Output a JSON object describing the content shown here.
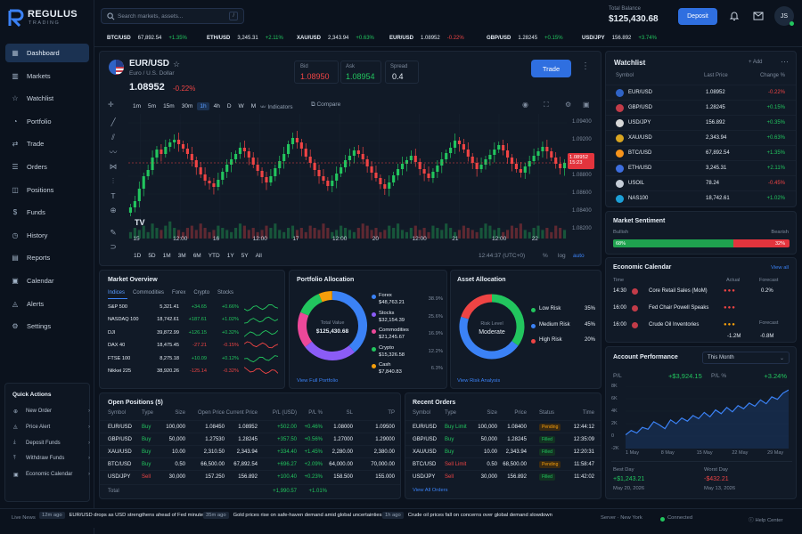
{
  "app": {
    "name": "REGULUS",
    "sub": "TRADING"
  },
  "search": {
    "placeholder": "Search markets, assets...",
    "shortcut": "/"
  },
  "balance": {
    "label": "Total Balance",
    "value": "$125,430.68"
  },
  "deposit_label": "Deposit",
  "user_initials": "JS",
  "nav": [
    {
      "label": "Dashboard",
      "icon": "grid-icon"
    },
    {
      "label": "Markets",
      "icon": "chart-icon"
    },
    {
      "label": "Watchlist",
      "icon": "star-icon"
    },
    {
      "label": "Portfolio",
      "icon": "pie-icon"
    },
    {
      "label": "Trade",
      "icon": "swap-icon"
    },
    {
      "label": "Orders",
      "icon": "list-icon"
    },
    {
      "label": "Positions",
      "icon": "layers-icon"
    },
    {
      "label": "Funds",
      "icon": "dollar-icon"
    },
    {
      "label": "History",
      "icon": "clock-icon"
    },
    {
      "label": "Reports",
      "icon": "file-icon"
    },
    {
      "label": "Calendar",
      "icon": "calendar-icon"
    },
    {
      "label": "Alerts",
      "icon": "bell-icon"
    },
    {
      "label": "Settings",
      "icon": "gear-icon"
    }
  ],
  "quick_actions": {
    "title": "Quick Actions",
    "items": [
      "New Order",
      "Price Alert",
      "Deposit Funds",
      "Withdraw Funds",
      "Economic Calendar"
    ]
  },
  "ticker": [
    {
      "sym": "BTC/USD",
      "price": "67,892.54",
      "chg": "+1.35%",
      "dir": "up"
    },
    {
      "sym": "ETH/USD",
      "price": "3,245.31",
      "chg": "+2.11%",
      "dir": "up"
    },
    {
      "sym": "XAU/USD",
      "price": "2,343.94",
      "chg": "+0.63%",
      "dir": "up"
    },
    {
      "sym": "EUR/USD",
      "price": "1.08952",
      "chg": "-0.22%",
      "dir": "down"
    },
    {
      "sym": "GBP/USD",
      "price": "1.28245",
      "chg": "+0.15%",
      "dir": "up"
    },
    {
      "sym": "USD/JPY",
      "price": "156.892",
      "chg": "+3.74%",
      "dir": "up"
    }
  ],
  "chart": {
    "pair": "EUR/USD",
    "desc": "Euro / U.S. Dollar",
    "price": "1.08952",
    "change": "-0.22%",
    "bid_label": "Bid",
    "bid": "1.08950",
    "ask_label": "Ask",
    "ask": "1.08954",
    "spread_label": "Spread",
    "spread": "0.4",
    "trade_label": "Trade",
    "timeframes": [
      "1m",
      "5m",
      "15m",
      "30m",
      "1h",
      "4h",
      "D",
      "W",
      "M"
    ],
    "active_tf": "1h",
    "indicators_label": "Indicators",
    "compare_label": "Compare",
    "yticks": [
      "1.09400",
      "1.09200",
      "1.09000",
      "1.08800",
      "1.08600",
      "1.08400",
      "1.08200"
    ],
    "xticks": [
      "15",
      "12:00",
      "16",
      "12:00",
      "17",
      "12:00",
      "20",
      "12:00",
      "21",
      "12:00",
      "22"
    ],
    "last_price": "1.08952",
    "last_time": "15:23",
    "ranges": [
      "1D",
      "5D",
      "1M",
      "3M",
      "6M",
      "YTD",
      "1Y",
      "5Y",
      "All"
    ],
    "clock": "12:44:37 (UTC+0)",
    "pct": "%",
    "log": "log",
    "auto": "auto"
  },
  "chart_data": {
    "type": "candlestick",
    "ylim": [
      1.081,
      1.095
    ],
    "closes": [
      1.0845,
      1.0852,
      1.0866,
      1.088,
      1.0887,
      1.0901,
      1.091,
      1.0905,
      1.0913,
      1.0918,
      1.0921,
      1.0916,
      1.0911,
      1.0905,
      1.0898,
      1.089,
      1.0882,
      1.0875,
      1.0872,
      1.0868,
      1.0876,
      1.0885,
      1.0893,
      1.0899,
      1.0905,
      1.0912,
      1.0908,
      1.0901,
      1.0893,
      1.0886,
      1.0879,
      1.0873,
      1.088,
      1.0889,
      1.0897,
      1.0905,
      1.0916,
      1.0923,
      1.0918,
      1.0911,
      1.0902,
      1.0895,
      1.0887,
      1.088,
      1.0875,
      1.0869,
      1.0875,
      1.0883,
      1.089,
      1.0898,
      1.0903,
      1.0909,
      1.0905,
      1.0899,
      1.0891,
      1.0884,
      1.0878,
      1.0871,
      1.0866,
      1.0873,
      1.0881,
      1.0888,
      1.0894,
      1.0898,
      1.0903,
      1.0896,
      1.0888,
      1.0883,
      1.0878,
      1.0885,
      1.0892,
      1.0899,
      1.0906,
      1.0912,
      1.092,
      1.0916,
      1.091,
      1.0902,
      1.0895,
      1.0888,
      1.0893,
      1.0899,
      1.0904,
      1.091,
      1.0915,
      1.0909,
      1.0901,
      1.0894,
      1.0888,
      1.0884,
      1.0891,
      1.0897,
      1.0903,
      1.0908,
      1.0913,
      1.0908,
      1.0901,
      1.0894,
      1.0889,
      1.0895
    ],
    "volumes": [
      3,
      5,
      4,
      6,
      3,
      7,
      5,
      4,
      6,
      8,
      5,
      4,
      3,
      5,
      6,
      4,
      7,
      5,
      3,
      4,
      6,
      5,
      4,
      3,
      5,
      7,
      6,
      4,
      5,
      3,
      4,
      6,
      5,
      7,
      4,
      3,
      5,
      6,
      4,
      5,
      3,
      6,
      5,
      4,
      7,
      5,
      3,
      4,
      6,
      5,
      4,
      3,
      5,
      7,
      6,
      4,
      5,
      3,
      4,
      6,
      5,
      7,
      4,
      3,
      5,
      6,
      4,
      5,
      3,
      6,
      5,
      4,
      7,
      5,
      3,
      4,
      6,
      5,
      4,
      3,
      5,
      7,
      6,
      4,
      5,
      3,
      4,
      6,
      5,
      7,
      4,
      3,
      5,
      6,
      4,
      5,
      3,
      6,
      5,
      4
    ]
  },
  "watchlist": {
    "title": "Watchlist",
    "add": "+ Add",
    "cols": [
      "Symbol",
      "Last Price",
      "Change %"
    ],
    "rows": [
      {
        "sym": "EUR/USD",
        "price": "1.08952",
        "chg": "-0.22%",
        "dir": "down",
        "icon": "eu-flag-icon",
        "col": "#2f63c6"
      },
      {
        "sym": "GBP/USD",
        "price": "1.28245",
        "chg": "+0.15%",
        "dir": "up",
        "icon": "uk-flag-icon",
        "col": "#c23b48"
      },
      {
        "sym": "USD/JPY",
        "price": "156.892",
        "chg": "+0.35%",
        "dir": "up",
        "icon": "us-flag-icon",
        "col": "#d8d8d8"
      },
      {
        "sym": "XAU/USD",
        "price": "2,343.94",
        "chg": "+0.63%",
        "dir": "up",
        "icon": "gold-icon",
        "col": "#d9a520"
      },
      {
        "sym": "BTC/USD",
        "price": "67,892.54",
        "chg": "+1.35%",
        "dir": "up",
        "icon": "bitcoin-icon",
        "col": "#f7931a"
      },
      {
        "sym": "ETH/USD",
        "price": "3,245.31",
        "chg": "+2.11%",
        "dir": "up",
        "icon": "ethereum-icon",
        "col": "#3d6ee0"
      },
      {
        "sym": "USOIL",
        "price": "78.24",
        "chg": "-0.45%",
        "dir": "down",
        "icon": "oil-drop-icon",
        "col": "#c5cdd8"
      },
      {
        "sym": "NAS100",
        "price": "18,742.61",
        "chg": "+1.02%",
        "dir": "up",
        "icon": "nasdaq-icon",
        "col": "#1c9fd6"
      }
    ]
  },
  "sentiment": {
    "title": "Market Sentiment",
    "bull_label": "Bullish",
    "bear_label": "Bearish",
    "bull": "68%",
    "bear": "32%",
    "bull_frac": 0.68
  },
  "calendar": {
    "title": "Economic Calendar",
    "view_all": "View all",
    "cols": [
      "Time",
      "Actual",
      "Forecast"
    ],
    "rows": [
      {
        "time": "14:30",
        "event": "Core Retail Sales (MoM)",
        "forecast": "0.2%",
        "actual": "",
        "imp": "red"
      },
      {
        "time": "16:00",
        "event": "Fed Chair Powell Speaks",
        "forecast": "",
        "actual": "",
        "imp": "red"
      },
      {
        "time": "16:00",
        "event": "Crude Oil Inventories",
        "forecast": "",
        "actual": "",
        "imp": "orange"
      }
    ],
    "extra_actual": "-1.2M",
    "extra_forecast": "-0.8M"
  },
  "performance": {
    "title": "Account Performance",
    "period": "This Month",
    "pl_label": "P/L",
    "pl": "+$3,924.15",
    "plpct_label": "P/L %",
    "plpct": "+3.24%",
    "yticks": [
      "8K",
      "6K",
      "4K",
      "2K",
      "0",
      "-2K"
    ],
    "xticks": [
      "1 May",
      "8 May",
      "15 May",
      "22 May",
      "29 May"
    ],
    "values": [
      0.2,
      0.9,
      0.5,
      1.4,
      1.1,
      2.3,
      1.8,
      1.2,
      2.6,
      2.0,
      2.9,
      2.4,
      3.3,
      2.8,
      3.8,
      3.1,
      4.2,
      3.6,
      4.6,
      3.9,
      4.9,
      4.4,
      5.3,
      4.8,
      5.8,
      5.2,
      6.3,
      5.9,
      6.9,
      7.4
    ],
    "best_label": "Best Day",
    "best": "+$1,243.21",
    "best_date": "May 20, 2026",
    "worst_label": "Worst Day",
    "worst": "-$432.21",
    "worst_date": "May 13, 2026"
  },
  "overview": {
    "title": "Market Overview",
    "tabs": [
      "Indices",
      "Commodities",
      "Forex",
      "Crypto",
      "Stocks"
    ],
    "rows": [
      {
        "name": "S&P 500",
        "price": "5,321.41",
        "chg": "+34.65",
        "pct": "+0.66%",
        "dir": "up"
      },
      {
        "name": "NASDAQ 100",
        "price": "18,742.61",
        "chg": "+187.61",
        "pct": "+1.02%",
        "dir": "up"
      },
      {
        "name": "DJI",
        "price": "39,872.99",
        "chg": "+126.15",
        "pct": "+0.32%",
        "dir": "up"
      },
      {
        "name": "DAX 40",
        "price": "18,475.45",
        "chg": "-27.21",
        "pct": "-0.15%",
        "dir": "down"
      },
      {
        "name": "FTSE 100",
        "price": "8,275.18",
        "chg": "+10.09",
        "pct": "+0.12%",
        "dir": "up"
      },
      {
        "name": "Nikkei 225",
        "price": "38,920.26",
        "chg": "-125.14",
        "pct": "-0.32%",
        "dir": "down"
      }
    ]
  },
  "portfolio": {
    "title": "Portfolio Allocation",
    "center_label": "Total Value",
    "center": "$125,430.68",
    "link": "View Full Portfolio",
    "items": [
      {
        "name": "Forex",
        "value": "$48,763.21",
        "pct": "38.9%",
        "frac": 0.389,
        "color": "#3b82f6"
      },
      {
        "name": "Stocks",
        "value": "$32,154.39",
        "pct": "25.6%",
        "frac": 0.256,
        "color": "#8b5cf6"
      },
      {
        "name": "Commodities",
        "value": "$21,245.67",
        "pct": "16.9%",
        "frac": 0.169,
        "color": "#ec4899"
      },
      {
        "name": "Crypto",
        "value": "$15,326.58",
        "pct": "12.2%",
        "frac": 0.122,
        "color": "#22c55e"
      },
      {
        "name": "Cash",
        "value": "$7,840.83",
        "pct": "6.3%",
        "frac": 0.063,
        "color": "#f59e0b"
      }
    ]
  },
  "asset_alloc": {
    "title": "Asset Allocation",
    "center_label": "Risk Level",
    "center": "Moderate",
    "link": "View Risk Analysis",
    "items": [
      {
        "name": "Low Risk",
        "pct": "35%",
        "frac": 0.35,
        "color": "#22c55e"
      },
      {
        "name": "Medium Risk",
        "pct": "45%",
        "frac": 0.45,
        "color": "#3b82f6"
      },
      {
        "name": "High Risk",
        "pct": "20%",
        "frac": 0.2,
        "color": "#ef4444"
      }
    ]
  },
  "positions": {
    "title": "Open Positions (5)",
    "cols": [
      "Symbol",
      "Type",
      "Size",
      "Open Price",
      "Current Price",
      "P/L (USD)",
      "P/L %",
      "SL",
      "TP"
    ],
    "rows": [
      [
        "EUR/USD",
        "Buy",
        "100,000",
        "1.08450",
        "1.08952",
        "+502.00",
        "+0.46%",
        "1.08000",
        "1.09500"
      ],
      [
        "GBP/USD",
        "Buy",
        "50,000",
        "1.27530",
        "1.28245",
        "+357.50",
        "+0.56%",
        "1.27000",
        "1.29000"
      ],
      [
        "XAU/USD",
        "Buy",
        "10.00",
        "2,310.50",
        "2,343.94",
        "+334.40",
        "+1.45%",
        "2,280.00",
        "2,380.00"
      ],
      [
        "BTC/USD",
        "Buy",
        "0.50",
        "66,500.00",
        "67,892.54",
        "+696.27",
        "+2.09%",
        "64,000.00",
        "70,000.00"
      ],
      [
        "USD/JPY",
        "Sell",
        "30,000",
        "157.250",
        "156.892",
        "+100.40",
        "+0.23%",
        "158.500",
        "155.000"
      ]
    ],
    "total_label": "Total",
    "total_pl": "+1,990.57",
    "total_pct": "+1.01%"
  },
  "orders": {
    "title": "Recent Orders",
    "cols": [
      "Symbol",
      "Type",
      "Size",
      "Price",
      "Status",
      "Time"
    ],
    "rows": [
      [
        "EUR/USD",
        "Buy Limit",
        "100,000",
        "1.08400",
        "Pending",
        "12:44:12"
      ],
      [
        "GBP/USD",
        "Buy",
        "50,000",
        "1.28245",
        "Filled",
        "12:35:09"
      ],
      [
        "XAU/USD",
        "Buy",
        "10.00",
        "2,343.94",
        "Filled",
        "12:20:31"
      ],
      [
        "BTC/USD",
        "Sell Limit",
        "0.50",
        "68,500.00",
        "Pending",
        "11:58:47"
      ],
      [
        "USD/JPY",
        "Sell",
        "30,000",
        "156.892",
        "Filled",
        "11:42:02"
      ]
    ],
    "view_all": "View All Orders"
  },
  "status": {
    "live_label": "Live News",
    "news": [
      {
        "age": "12m ago",
        "text": "EUR/USD drops as USD strengthens ahead of Fed minutes"
      },
      {
        "age": "35m ago",
        "text": "Gold prices rise on safe-haven demand amid global uncertainties"
      },
      {
        "age": "1h ago",
        "text": "Crude oil prices fall on concerns over global demand slowdown"
      }
    ],
    "server_label": "Server",
    "server": "New York",
    "connected": "Connected",
    "help": "Help Center"
  },
  "colors": {
    "up": "#22c55e",
    "down": "#ef4444",
    "accent": "#2f6fe0"
  }
}
